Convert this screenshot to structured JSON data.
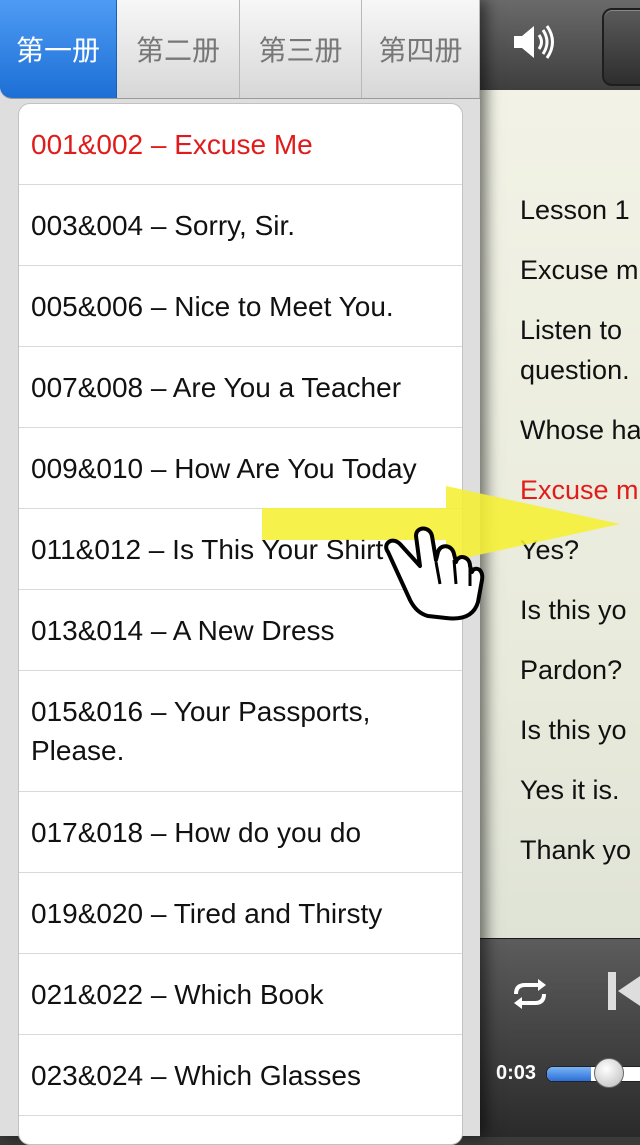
{
  "tabs": [
    {
      "label": "第一册",
      "active": true
    },
    {
      "label": "第二册",
      "active": false
    },
    {
      "label": "第三册",
      "active": false
    },
    {
      "label": "第四册",
      "active": false
    }
  ],
  "lessons": [
    {
      "label": "001&002 – Excuse Me",
      "selected": true
    },
    {
      "label": "003&004 – Sorry, Sir.",
      "selected": false
    },
    {
      "label": "005&006 – Nice to Meet You.",
      "selected": false
    },
    {
      "label": "007&008 – Are You a Teacher",
      "selected": false
    },
    {
      "label": "009&010 – How Are You Today",
      "selected": false
    },
    {
      "label": "011&012 – Is This Your Shirt",
      "selected": false
    },
    {
      "label": "013&014 – A New Dress",
      "selected": false
    },
    {
      "label": "015&016 – Your Passports, Please.",
      "selected": false
    },
    {
      "label": "017&018 – How do you do",
      "selected": false
    },
    {
      "label": "019&020 – Tired and Thirsty",
      "selected": false
    },
    {
      "label": "021&022 – Which Book",
      "selected": false
    },
    {
      "label": "023&024 – Which Glasses",
      "selected": false
    }
  ],
  "reader": {
    "lines": [
      {
        "text": "Lesson 1",
        "highlight": false
      },
      {
        "text": "Excuse m",
        "highlight": false
      },
      {
        "text": "Listen to",
        "highlight": false
      },
      {
        "text": "question.",
        "highlight": false
      },
      {
        "text": "Whose ha",
        "highlight": false
      },
      {
        "text": "Excuse m",
        "highlight": true
      },
      {
        "text": "Yes?",
        "highlight": false
      },
      {
        "text": "Is this yo",
        "highlight": false
      },
      {
        "text": "Pardon?",
        "highlight": false
      },
      {
        "text": "Is this yo",
        "highlight": false
      },
      {
        "text": "Yes it is.",
        "highlight": false
      },
      {
        "text": "Thank yo",
        "highlight": false
      }
    ],
    "player": {
      "time": "0:03",
      "progress": 0.04,
      "icons": [
        "speaker-icon",
        "repeat-icon",
        "previous-track-icon"
      ]
    }
  },
  "overlay": {
    "icons": [
      "swipe-right-arrow-icon",
      "pointing-hand-icon"
    ]
  },
  "colors": {
    "accent": "#1d6fd6",
    "selected_text": "#e01b1b",
    "arrow": "#f5f032"
  }
}
